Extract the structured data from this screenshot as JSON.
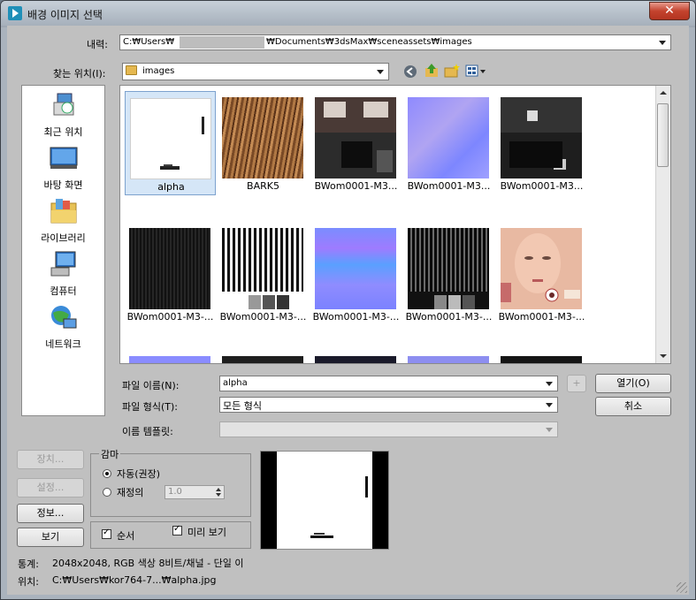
{
  "window": {
    "title": "배경 이미지 선택",
    "close_glyph": "✕"
  },
  "history": {
    "label": "내력:",
    "path_start": "C:₩Users₩",
    "path_end": "₩Documents₩3dsMax₩sceneassets₩images"
  },
  "lookin": {
    "label": "찾는 위치(I):",
    "value": "images"
  },
  "places": [
    {
      "label": "최근 위치",
      "icon": "recent-places-icon"
    },
    {
      "label": "바탕 화면",
      "icon": "desktop-icon"
    },
    {
      "label": "라이브러리",
      "icon": "libraries-icon"
    },
    {
      "label": "컴퓨터",
      "icon": "computer-icon"
    },
    {
      "label": "네트워크",
      "icon": "network-icon"
    }
  ],
  "files": [
    {
      "name": "alpha",
      "selected": true
    },
    {
      "name": "BARK5"
    },
    {
      "name": "BWom0001-M3..."
    },
    {
      "name": "BWom0001-M3..."
    },
    {
      "name": "BWom0001-M3..."
    },
    {
      "name": "BWom0001-M3-..."
    },
    {
      "name": "BWom0001-M3-..."
    },
    {
      "name": "BWom0001-M3-..."
    },
    {
      "name": "BWom0001-M3-..."
    },
    {
      "name": "BWom0001-M3-..."
    }
  ],
  "filename": {
    "label": "파일 이름(N):",
    "value": "alpha",
    "plus": "+"
  },
  "filetype": {
    "label": "파일 형식(T):",
    "value": "모든 형식"
  },
  "template": {
    "label": "이름 템플릿:",
    "value": ""
  },
  "buttons": {
    "open": "열기(O)",
    "cancel": "취소",
    "setup": "장치...",
    "settings": "설정...",
    "info": "정보...",
    "view": "보기"
  },
  "gamma": {
    "title": "감마",
    "auto": "자동(권장)",
    "override": "재정의",
    "override_value": "1.0"
  },
  "options": {
    "sequence": "순서",
    "preview": "미리 보기"
  },
  "stats": {
    "label": "통계:",
    "value": "2048x2048, RGB 색상 8비트/채널 - 단일 이"
  },
  "location": {
    "label": "위치:",
    "value": "C:₩Users₩kor764-7...₩alpha.jpg"
  }
}
